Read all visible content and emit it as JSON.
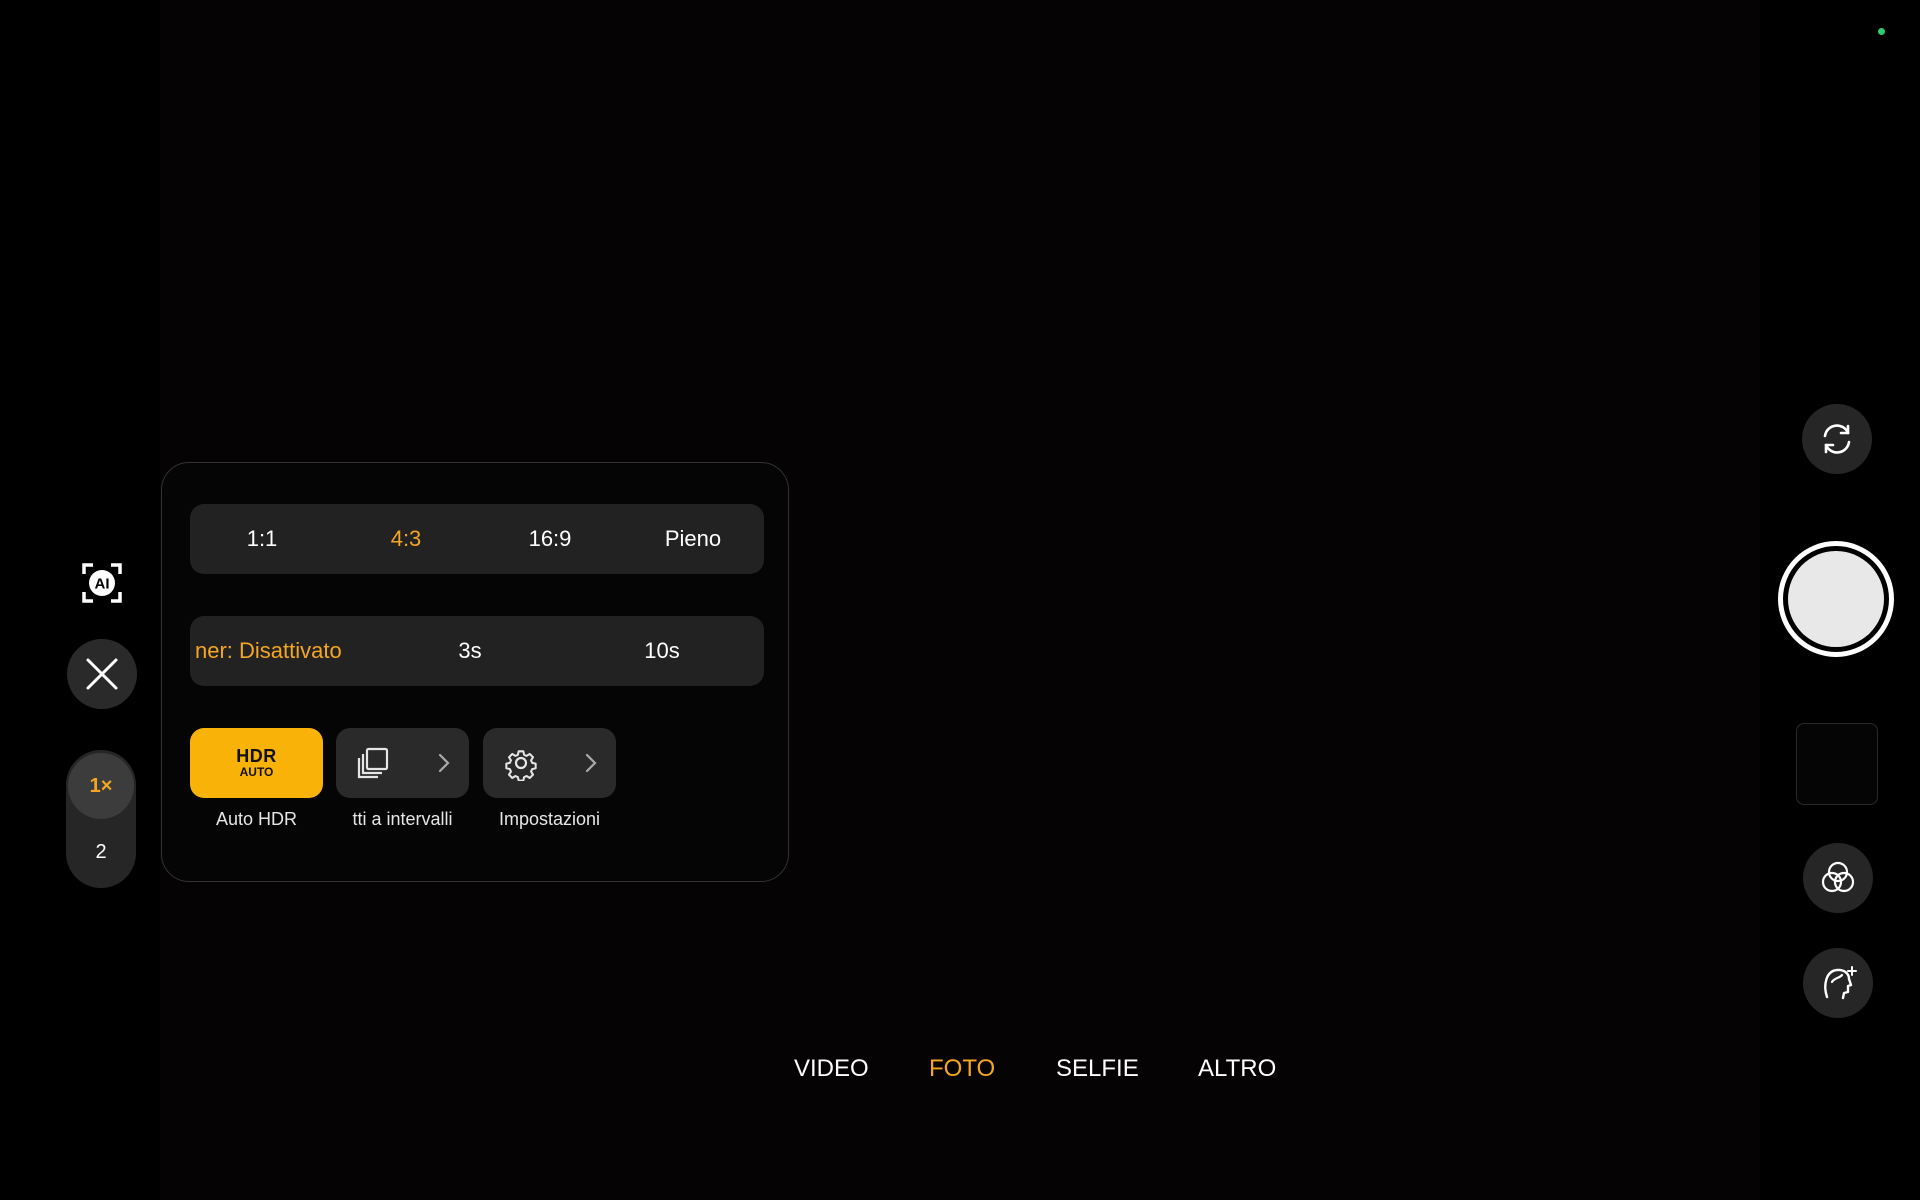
{
  "aspect_ratio": {
    "options": [
      "1:1",
      "4:3",
      "16:9",
      "Pieno"
    ],
    "selected": "4:3"
  },
  "timer": {
    "options": [
      "ner: Disattivato",
      "3s",
      "10s"
    ],
    "selected": "ner: Disattivato"
  },
  "quick_tiles": {
    "hdr": {
      "badge_main": "HDR",
      "badge_sub": "AUTO",
      "label": "Auto HDR",
      "active": true,
      "icon": "hdr-auto-icon"
    },
    "interval": {
      "label": "tti a intervalli",
      "icon": "burst-photos-icon"
    },
    "settings": {
      "label": "Impostazioni",
      "icon": "gear-icon"
    }
  },
  "zoom": {
    "active_label": "1×",
    "other_label": "2"
  },
  "modes": {
    "items": [
      "VIDEO",
      "FOTO",
      "SELFIE",
      "ALTRO"
    ],
    "selected": "FOTO"
  },
  "colors": {
    "accent": "#f5a623",
    "hdr_tile": "#f9b208",
    "status_dot": "#2ecc71",
    "button_bg": "#262626"
  },
  "icons": {
    "ai": "ai-scene-icon",
    "close": "close-icon",
    "switch_camera": "switch-camera-icon",
    "filters": "filters-icon",
    "portrait_beauty": "face-retouch-icon"
  }
}
